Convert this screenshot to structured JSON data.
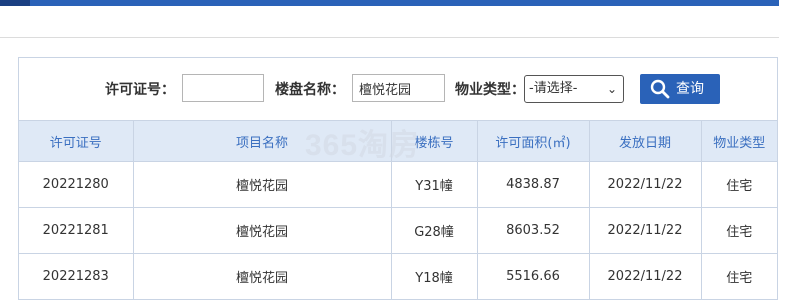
{
  "search": {
    "permit_label": "许可证号：",
    "permit_value": "",
    "project_label": "楼盘名称：",
    "project_value": "檀悦花园",
    "type_label": "物业类型：",
    "type_selected": "-请选择-",
    "query_button": "查询"
  },
  "table": {
    "headers": [
      "许可证号",
      "项目名称",
      "楼栋号",
      "许可面积(㎡)",
      "发放日期",
      "物业类型"
    ],
    "rows": [
      [
        "20221280",
        "檀悦花园",
        "Y31幢",
        "4838.87",
        "2022/11/22",
        "住宅"
      ],
      [
        "20221281",
        "檀悦花园",
        "G28幢",
        "8603.52",
        "2022/11/22",
        "住宅"
      ],
      [
        "20221283",
        "檀悦花园",
        "Y18幢",
        "5516.66",
        "2022/11/22",
        "住宅"
      ]
    ]
  },
  "watermark": "365淘房",
  "colors": {
    "accent": "#2a62b8",
    "header_bg": "#dfe9f6",
    "header_text": "#3a6fc0",
    "border": "#c9d4e4"
  }
}
